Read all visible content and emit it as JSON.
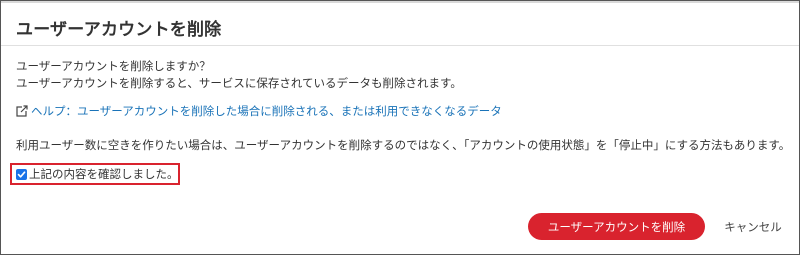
{
  "dialog": {
    "title": "ユーザーアカウントを削除",
    "message_line1": "ユーザーアカウントを削除しますか？",
    "message_line2": "ユーザーアカウントを削除すると、サービスに保存されているデータも削除されます。",
    "help_link": "ヘルプ：ユーザーアカウントを削除した場合に削除される、または利用できなくなるデータ",
    "note": "利用ユーザー数に空きを作りたい場合は、ユーザーアカウントを削除するのではなく、「アカウントの使用状態」を「停止中」にする方法もあります。",
    "confirm_label": "上記の内容を確認しました。",
    "confirm_checked": true,
    "delete_button": "ユーザーアカウントを削除",
    "cancel_button": "キャンセル"
  },
  "colors": {
    "accent_red": "#d9232e",
    "link_blue": "#1a73b8",
    "checkbox_blue": "#1a73e8"
  },
  "icons": {
    "help_link_icon": "external-link-icon",
    "checkbox_icon": "checkmark-icon"
  }
}
